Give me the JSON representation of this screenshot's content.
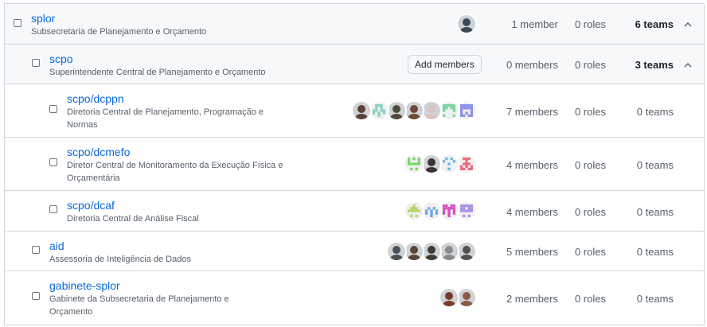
{
  "teams": [
    {
      "name": "splor",
      "description": "Subsecretaria de Planejamento e Orçamento",
      "members": "1 member",
      "roles": "0 roles",
      "teams": "6 teams",
      "avatars": [
        {
          "type": "photo",
          "color": "#3a4a54"
        }
      ]
    },
    {
      "name": "scpo",
      "description": "Superintendente Central de Planejamento e Orçamento",
      "add_members_label": "Add members",
      "members": "0 members",
      "roles": "0 roles",
      "teams": "3 teams"
    },
    {
      "name": "scpo/dcppn",
      "description": "Diretoria Central de Planejamento, Programação e Normas",
      "members": "7 members",
      "roles": "0 roles",
      "teams": "0 teams",
      "avatars": [
        {
          "type": "photo",
          "color": "#5b4038"
        },
        {
          "type": "identicon",
          "color": "#8ad2c4"
        },
        {
          "type": "photo",
          "color": "#4f4a3e"
        },
        {
          "type": "photo",
          "color": "#6a4a3a"
        },
        {
          "type": "photo",
          "color": "#d8c4c0"
        },
        {
          "type": "identicon",
          "color": "#7bd4a0"
        },
        {
          "type": "identicon",
          "color": "#8a90e6"
        }
      ]
    },
    {
      "name": "scpo/dcmefo",
      "description": "Diretor Central de Monitoramento da Execução Física e Orçamentária",
      "members": "4 members",
      "roles": "0 roles",
      "teams": "0 teams",
      "avatars": [
        {
          "type": "identicon",
          "color": "#7ad26e"
        },
        {
          "type": "photo",
          "color": "#3b3430"
        },
        {
          "type": "identicon",
          "color": "#6ab4e6"
        },
        {
          "type": "identicon",
          "color": "#e86a7c"
        }
      ]
    },
    {
      "name": "scpo/dcaf",
      "description": "Diretoria Central de Análise Fiscal",
      "members": "4 members",
      "roles": "0 roles",
      "teams": "0 teams",
      "avatars": [
        {
          "type": "identicon",
          "color": "#b8d26a"
        },
        {
          "type": "identicon",
          "color": "#6aa8e6"
        },
        {
          "type": "identicon",
          "color": "#d64ec4"
        },
        {
          "type": "identicon",
          "color": "#a890e0"
        }
      ]
    },
    {
      "name": "aid",
      "description": "Assessoria de Inteligência de Dados",
      "members": "5 members",
      "roles": "0 roles",
      "teams": "0 teams",
      "avatars": [
        {
          "type": "photo",
          "color": "#4a5258"
        },
        {
          "type": "photo",
          "color": "#5a4438"
        },
        {
          "type": "photo",
          "color": "#3e3a36"
        },
        {
          "type": "photo",
          "color": "#8a8a8a"
        },
        {
          "type": "photo",
          "color": "#505050"
        }
      ]
    },
    {
      "name": "gabinete-splor",
      "description": "Gabinete da Subsecretaria de Planejamento e Orçamento",
      "members": "2 members",
      "roles": "0 roles",
      "teams": "0 teams",
      "avatars": [
        {
          "type": "photo",
          "color": "#7a3a28"
        },
        {
          "type": "photo",
          "color": "#8a5a44"
        }
      ]
    }
  ]
}
